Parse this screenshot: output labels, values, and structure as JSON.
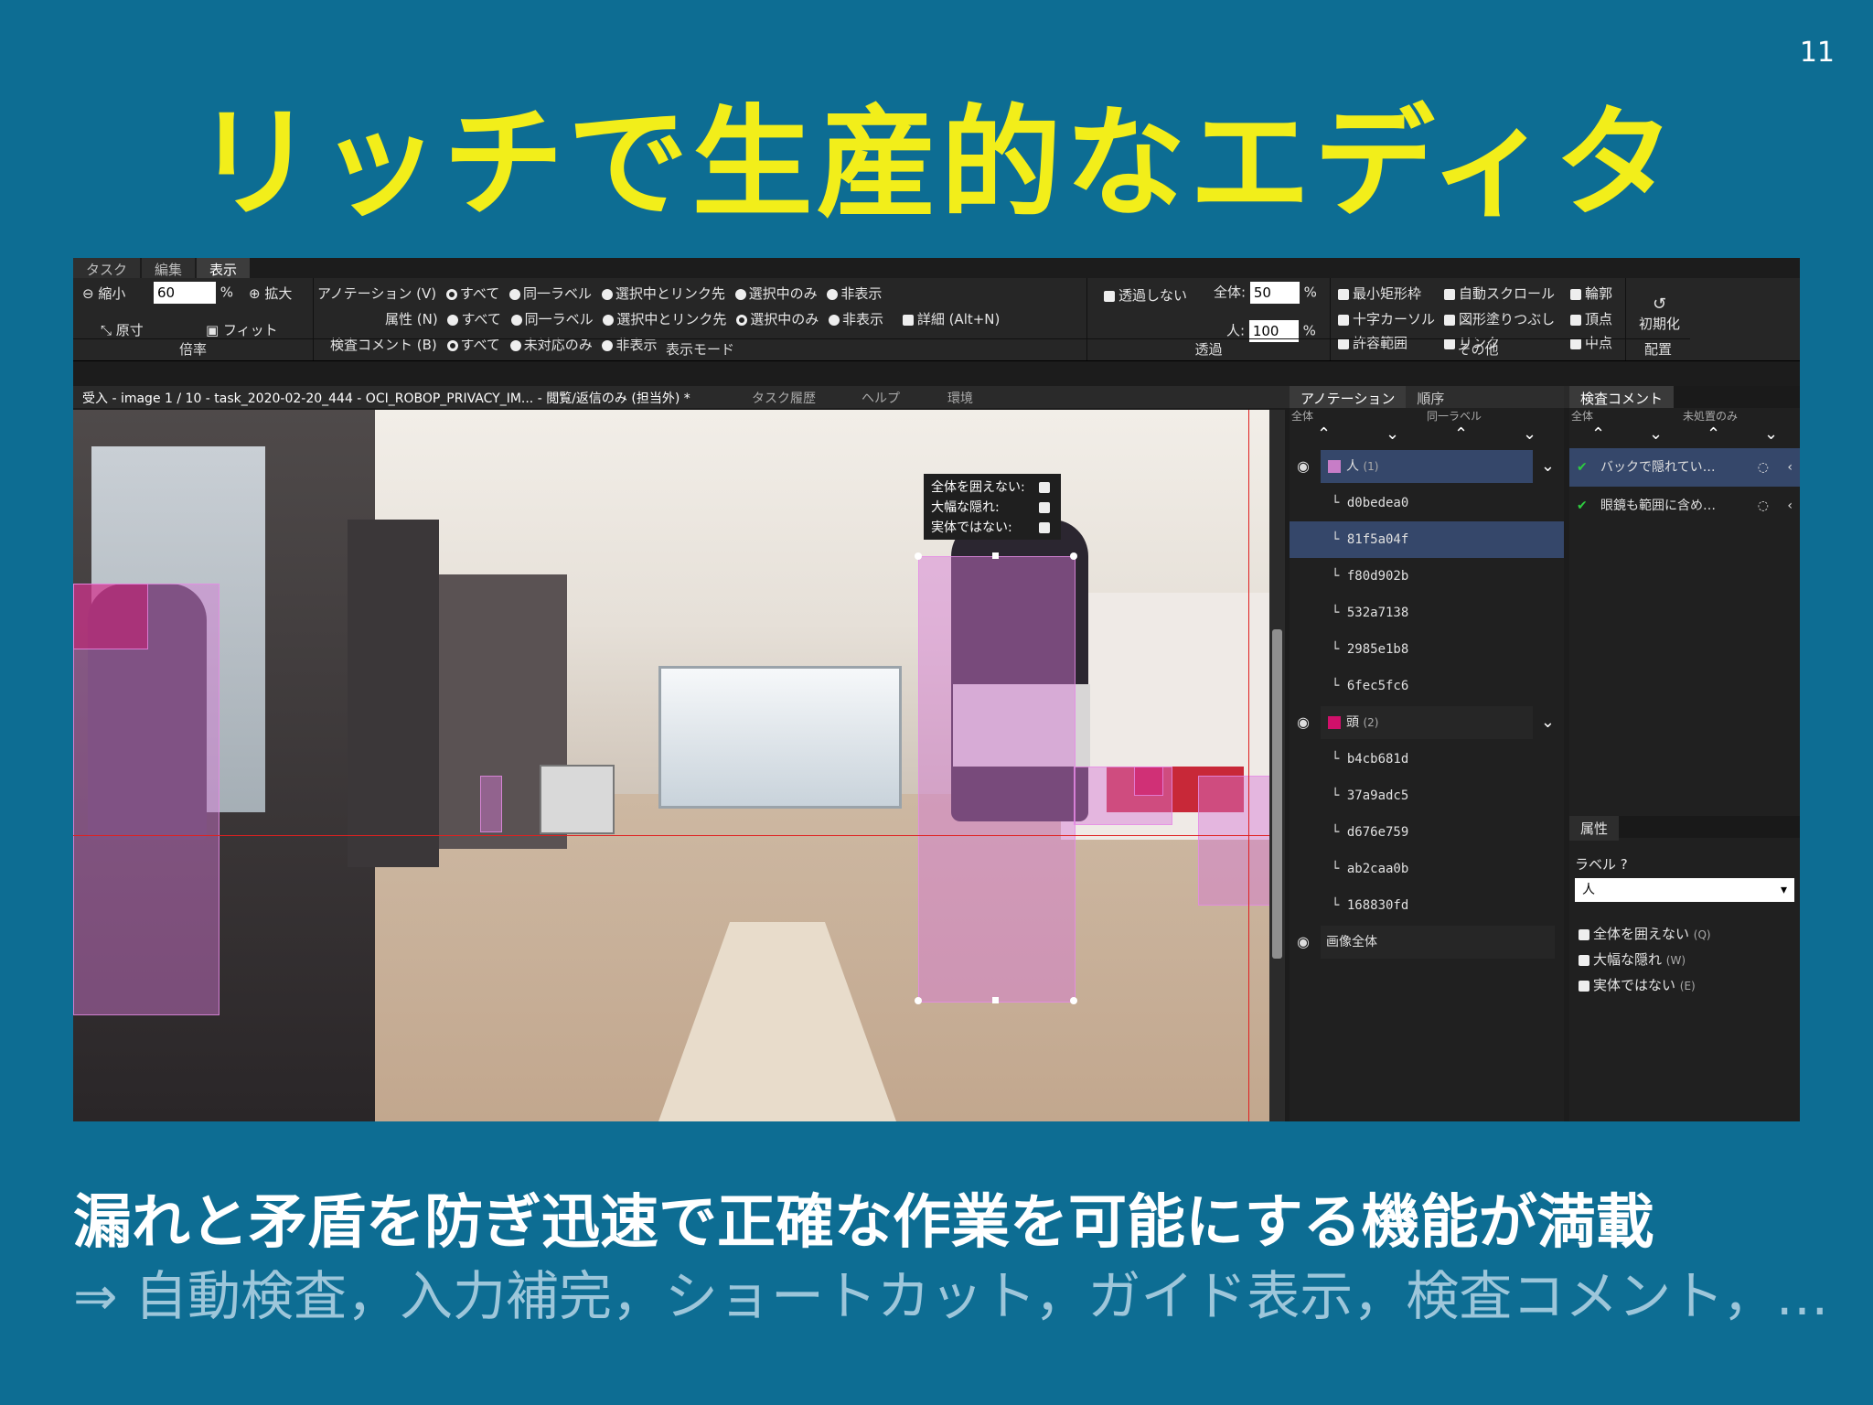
{
  "slide": {
    "number": "11",
    "title": "リッチで生産的なエディタ",
    "subtitle": "漏れと矛盾を防ぎ迅速で正確な作業を可能にする機能が満載",
    "features": "⇒ 自動検査，入力補完，ショートカット，ガイド表示，検査コメント，…"
  },
  "editor": {
    "tabs": [
      "タスク",
      "編集",
      "表示"
    ],
    "zoom": {
      "shrink": "縮小",
      "value": "60",
      "unit": "%",
      "enlarge": "拡大",
      "original": "原寸",
      "fit": "フィット",
      "group": "倍率"
    },
    "display_mode": {
      "row1_label": "アノテーション (V)",
      "row2_label": "属性 (N)",
      "row3_label": "検査コメント (B)",
      "opt_all": "すべて",
      "opt_same": "同一ラベル",
      "opt_linked": "選択中とリンク先",
      "opt_selected": "選択中のみ",
      "opt_hide": "非表示",
      "opt_unhandled": "未対応のみ",
      "detail": "詳細 (Alt+N)",
      "group": "表示モード"
    },
    "transparency": {
      "no_transparent": "透過しない",
      "all_label": "全体:",
      "all_value": "50",
      "all_unit": "%",
      "person_label": "人:",
      "person_value": "100",
      "person_unit": "%",
      "group": "透過"
    },
    "other": {
      "min_rect": "最小矩形枠",
      "auto_scroll": "自動スクロール",
      "outline": "輪郭",
      "crosshair": "十字カーソル",
      "fill": "図形塗りつぶし",
      "vertex": "頂点",
      "tolerance": "許容範囲",
      "link": "リンク",
      "midpoint": "中点",
      "group": "その他"
    },
    "layout": {
      "reset": "初期化",
      "group": "配置"
    },
    "status": {
      "file": "受入 - image 1 / 10 - task_2020-02-20_444 - OCI_ROBOP_PRIVACY_IM... - 閲覧/返信のみ (担当外) *",
      "history": "タスク履歴",
      "help": "ヘルプ",
      "env": "環境"
    },
    "popup": {
      "line1": "全体を囲えない:",
      "line2": "大幅な隠れ:",
      "line3": "実体ではない:"
    },
    "annotation_panel": {
      "tab1": "アノテーション",
      "tab2": "順序",
      "sort_all": "全体",
      "sort_same": "同一ラベル",
      "group_person": "人",
      "group_person_count": "(1)",
      "person_items": [
        "d0bedea0",
        "81f5a04f",
        "f80d902b",
        "532a7138",
        "2985e1b8",
        "6fec5fc6"
      ],
      "group_head": "頭",
      "group_head_count": "(2)",
      "head_items": [
        "b4cb681d",
        "37a9adc5",
        "d676e759",
        "ab2caa0b",
        "168830fd"
      ],
      "whole_image": "画像全体"
    },
    "inspection_panel": {
      "tab": "検査コメント",
      "sort_all": "全体",
      "sort_unhandled": "未処置のみ",
      "comments": [
        "バックで隠れてい…",
        "眼鏡も範囲に含め…"
      ],
      "attr_tab": "属性",
      "label_field": "ラベル",
      "label_value": "人",
      "attr_options": [
        "全体を囲えない",
        "大幅な隠れ",
        "実体ではない"
      ],
      "attr_keys": [
        "(Q)",
        "(W)",
        "(E)"
      ]
    }
  },
  "colors": {
    "background": "#0d6d93",
    "title": "#f2ee1a",
    "person_swatch": "#c77dc7",
    "head_swatch": "#d0106a"
  }
}
